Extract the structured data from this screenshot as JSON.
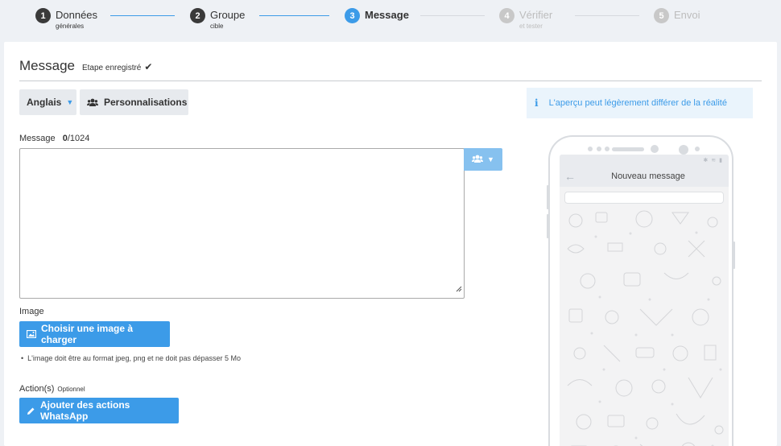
{
  "stepper": {
    "steps": [
      {
        "num": "1",
        "title": "Données",
        "sub": "générales"
      },
      {
        "num": "2",
        "title": "Groupe",
        "sub": "cible"
      },
      {
        "num": "3",
        "title": "Message",
        "sub": ""
      },
      {
        "num": "4",
        "title": "Vérifier",
        "sub": "et tester"
      },
      {
        "num": "5",
        "title": "Envoi",
        "sub": ""
      }
    ]
  },
  "header": {
    "title": "Message",
    "status": "Etape enregistré"
  },
  "toolbar": {
    "language": "Anglais",
    "personalize": "Personnalisations"
  },
  "info": {
    "text": "L'aperçu peut légèrement différer de la réalité"
  },
  "message": {
    "label": "Message",
    "count": "0",
    "max": "/1024",
    "value": ""
  },
  "image": {
    "label": "Image",
    "button": "Choisir une image à charger",
    "note": "L'image doit être au format jpeg, png et ne doit pas dépasser 5 Mo"
  },
  "actions": {
    "label": "Action(s)",
    "optional": "Optionnel",
    "button": "Ajouter des actions WhatsApp"
  },
  "preview": {
    "title": "Nouveau message"
  },
  "colors": {
    "accent": "#3c9be8",
    "accent_light": "#86c1ef",
    "info_bg": "#eaf4fc"
  }
}
